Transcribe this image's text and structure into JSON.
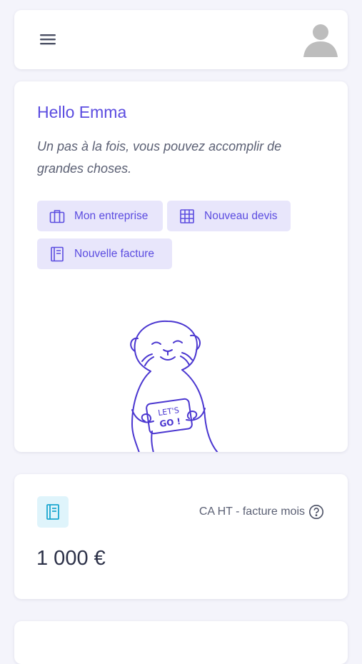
{
  "header": {
    "menu_icon": "hamburger-menu-icon",
    "avatar_icon": "user-avatar-icon"
  },
  "welcome": {
    "greeting": "Hello Emma",
    "subtitle": "Un pas à la fois, vous pouvez accomplir de grandes choses.",
    "actions": [
      {
        "label": "Mon entreprise",
        "icon": "briefcase-icon"
      },
      {
        "label": "Nouveau devis",
        "icon": "grid-icon"
      },
      {
        "label": "Nouvelle facture",
        "icon": "invoice-icon"
      }
    ],
    "illustration": {
      "sign_line1": "LET'S",
      "sign_line2": "GO !"
    }
  },
  "stats": {
    "icon": "invoice-book-icon",
    "label": "CA HT - facture mois",
    "help_icon": "help-circle-icon",
    "value": "1 000 €"
  },
  "colors": {
    "accent": "#5b4ce0",
    "accent_bg": "#e8e6fb",
    "info_bg": "#dff4fb",
    "info": "#1aa6cf",
    "page_bg": "#f4f4fb"
  }
}
